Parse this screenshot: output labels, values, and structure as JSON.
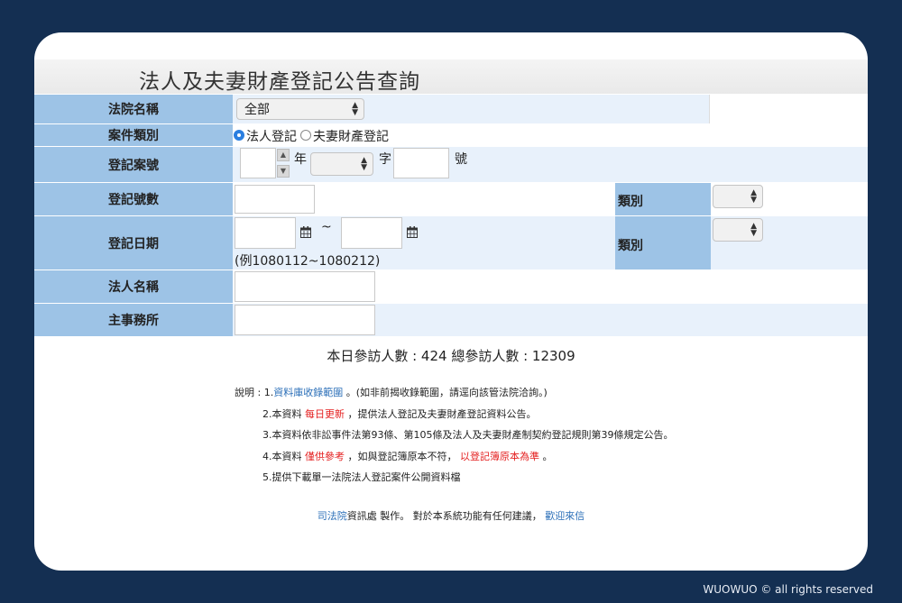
{
  "page_title": "法人及夫妻財產登記公告查詢",
  "rows": {
    "court": {
      "label": "法院名稱",
      "selected": "全部"
    },
    "case_type": {
      "label": "案件類別",
      "option1": "法人登記",
      "option2": "夫妻財產登記",
      "selected": "法人登記"
    },
    "reg_no": {
      "label": "登記案號",
      "year_unit": "年",
      "word_unit": "字",
      "number_unit": "號"
    },
    "reg_count": {
      "label": "登記號數",
      "category_label": "類別"
    },
    "reg_date": {
      "label": "登記日期",
      "separator": "~",
      "example": "(例1080112~1080212)",
      "category_label": "類別"
    },
    "corp_name": {
      "label": "法人名稱"
    },
    "office": {
      "label": "主事務所"
    }
  },
  "visitors": "本日參訪人數 : 424  總參訪人數 : 12309",
  "notes": {
    "prefix": "說明 : ",
    "n1_a": "1.",
    "n1_link": "資料庫收錄範圍",
    "n1_b": " 。(如非前揭收錄範圍，請逕向該管法院洽詢。)",
    "n2_a": "2.本資料 ",
    "n2_red": "每日更新",
    "n2_b": " ，提供法人登記及夫妻財產登記資料公告。",
    "n3": "3.本資料依非訟事件法第93條、第105條及法人及夫妻財產制契約登記規則第39條規定公告。",
    "n4_a": "4.本資料 ",
    "n4_red1": "僅供參考",
    "n4_b": " ，如與登記簿原本不符， ",
    "n4_red2": "以登記簿原本為準",
    "n4_c": " 。",
    "n5": "5.提供下載單一法院法人登記案件公開資料檔"
  },
  "footer": {
    "link1": "司法院",
    "text": "資訊處 製作。 對於本系統功能有任何建議， ",
    "link2": "歡迎來信"
  },
  "copyright": "WUOWUO © all rights reserved",
  "colors": {
    "background": "#142f52",
    "label_bg": "#9dc3e6",
    "value_bg": "#e8f1fb",
    "link": "#2b6fb8",
    "red": "#e41f1f"
  }
}
